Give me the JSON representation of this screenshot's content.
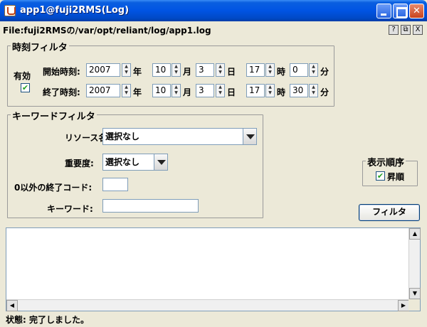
{
  "window": {
    "title": "app1@fuji2RMS(Log)"
  },
  "file_path": "File:fuji2RMSの/var/opt/reliant/log/app1.log",
  "time_filter": {
    "legend": "時刻フィルタ",
    "enabled_label": "有効",
    "enabled": true,
    "start": {
      "label": "開始時刻:",
      "year": "2007",
      "month": "10",
      "day": "3",
      "hour": "17",
      "minute": "0"
    },
    "end": {
      "label": "終了時刻:",
      "year": "2007",
      "month": "10",
      "day": "3",
      "hour": "17",
      "minute": "30"
    },
    "units": {
      "year": "年",
      "month": "月",
      "day": "日",
      "hour": "時",
      "minute": "分"
    }
  },
  "keyword_filter": {
    "legend": "キーワードフィルタ",
    "resource_label": "リソース名:",
    "resource_value": "選択なし",
    "severity_label": "重要度:",
    "severity_value": "選択なし",
    "exit_code_label": "0以外の終了コード:",
    "exit_code_value": "",
    "keyword_label": "キーワード:",
    "keyword_value": ""
  },
  "display_order": {
    "legend": "表示順序",
    "ascending_label": "昇順",
    "ascending": true
  },
  "filter_button": "フィルタ",
  "status": "状態: 完了しました。",
  "icons": {
    "help": "?",
    "restore": "restore-icon",
    "close": "X",
    "checkbox_mark": "✔"
  }
}
